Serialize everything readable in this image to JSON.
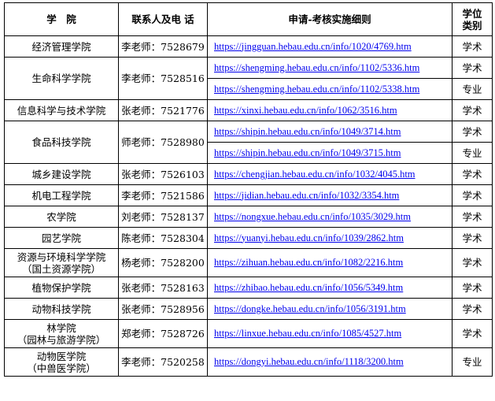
{
  "header": {
    "college": "学　院",
    "contact": "联系人及电 话",
    "rules": "申请-考核实施细则",
    "type_line1": "学位",
    "type_line2": "类别"
  },
  "rows": [
    {
      "college": [
        "经济管理学院"
      ],
      "contact": "李老师：7528679",
      "links": [
        {
          "url": "https://jingguan.hebau.edu.cn/info/1020/4769.htm",
          "type": "学术"
        }
      ]
    },
    {
      "college": [
        "生命科学学院"
      ],
      "contact": "李老师：7528516",
      "links": [
        {
          "url": "https://shengming.hebau.edu.cn/info/1102/5336.htm",
          "type": "学术"
        },
        {
          "url": "https://shengming.hebau.edu.cn/info/1102/5338.htm",
          "type": "专业"
        }
      ]
    },
    {
      "college": [
        "信息科学与技术学院"
      ],
      "contact": "张老师：7521776",
      "links": [
        {
          "url": "https://xinxi.hebau.edu.cn/info/1062/3516.htm",
          "type": "学术"
        }
      ]
    },
    {
      "college": [
        "食品科技学院"
      ],
      "contact": "师老师：7528980",
      "links": [
        {
          "url": "https://shipin.hebau.edu.cn/info/1049/3714.htm",
          "type": "学术"
        },
        {
          "url": "https://shipin.hebau.edu.cn/info/1049/3715.htm",
          "type": "专业"
        }
      ]
    },
    {
      "college": [
        "城乡建设学院"
      ],
      "contact": "张老师：7526103",
      "links": [
        {
          "url": "https://chengjian.hebau.edu.cn/info/1032/4045.htm",
          "type": "学术"
        }
      ]
    },
    {
      "college": [
        "机电工程学院"
      ],
      "contact": "李老师：7521586",
      "links": [
        {
          "url": "https://jidian.hebau.edu.cn/info/1032/3354.htm",
          "type": "学术"
        }
      ]
    },
    {
      "college": [
        "农学院"
      ],
      "contact": "刘老师：7528137",
      "links": [
        {
          "url": "https://nongxue.hebau.edu.cn/info/1035/3029.htm",
          "type": "学术"
        }
      ]
    },
    {
      "college": [
        "园艺学院"
      ],
      "contact": "陈老师：7528304",
      "links": [
        {
          "url": "https://yuanyi.hebau.edu.cn/info/1039/2862.htm",
          "type": "学术"
        }
      ]
    },
    {
      "college": [
        "资源与环境科学学院",
        "（国土资源学院）"
      ],
      "contact": "杨老师：7528200",
      "links": [
        {
          "url": "https://zihuan.hebau.edu.cn/info/1082/2216.htm",
          "type": "学术"
        }
      ]
    },
    {
      "college": [
        "植物保护学院"
      ],
      "contact": "张老师：7528163",
      "links": [
        {
          "url": "https://zhibao.hebau.edu.cn/info/1056/5349.htm",
          "type": "学术"
        }
      ]
    },
    {
      "college": [
        "动物科技学院"
      ],
      "contact": "张老师：7528956",
      "links": [
        {
          "url": "https://dongke.hebau.edu.cn/info/1056/3191.htm",
          "type": "学术"
        }
      ]
    },
    {
      "college": [
        "林学院",
        "（园林与旅游学院）"
      ],
      "contact": "郑老师：7528726",
      "links": [
        {
          "url": "https://linxue.hebau.edu.cn/info/1085/4527.htm",
          "type": "学术"
        }
      ]
    },
    {
      "college": [
        "动物医学院",
        "（中兽医学院）"
      ],
      "contact": "李老师：7520258",
      "links": [
        {
          "url": "https://dongyi.hebau.edu.cn/info/1118/3200.htm",
          "type": "专业"
        }
      ]
    }
  ]
}
